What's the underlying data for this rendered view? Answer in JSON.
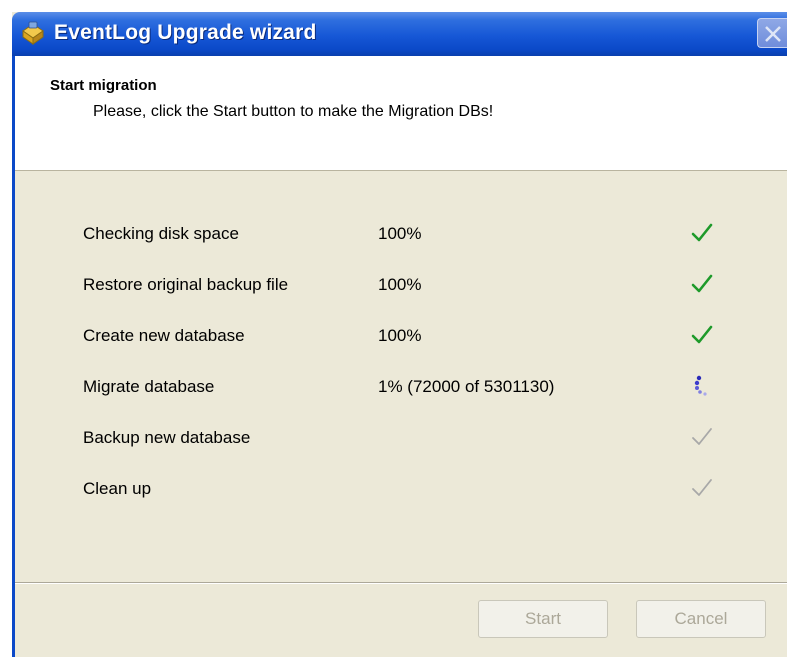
{
  "window": {
    "title": "EventLog Upgrade wizard",
    "icon": "package-icon",
    "title_bar_color": "#1657d6"
  },
  "header": {
    "title": "Start migration",
    "subtitle": "Please, click the Start button to make the Migration DBs!"
  },
  "steps": [
    {
      "label": "Checking disk space",
      "progress": "100%",
      "status": "done"
    },
    {
      "label": "Restore original backup file",
      "progress": "100%",
      "status": "done"
    },
    {
      "label": "Create new database",
      "progress": "100%",
      "status": "done"
    },
    {
      "label": "Migrate database",
      "progress": "1%  (72000 of 5301130)",
      "status": "in-progress"
    },
    {
      "label": "Backup new database",
      "progress": "",
      "status": "pending"
    },
    {
      "label": "Clean up",
      "progress": "",
      "status": "pending"
    }
  ],
  "status_colors": {
    "done": "#1e9a2a",
    "pending": "#a8a8a8",
    "in_progress": "#3c3ccc"
  },
  "buttons": {
    "start_label": "Start",
    "cancel_label": "Cancel"
  }
}
